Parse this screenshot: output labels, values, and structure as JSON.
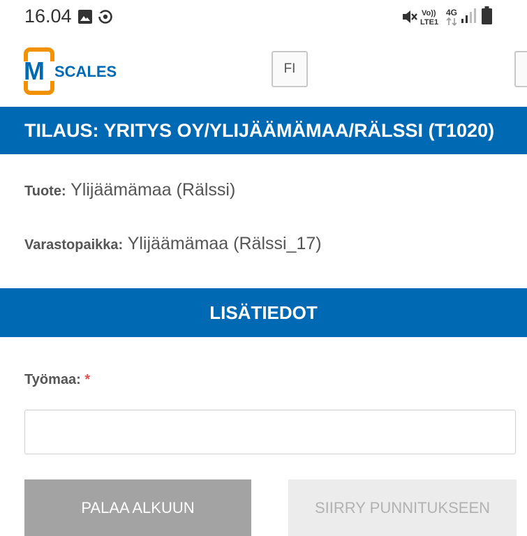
{
  "status_bar": {
    "time": "16.04",
    "icons": [
      "gallery-icon",
      "sync-icon",
      "mute-icon",
      "volte-icon",
      "4g-icon",
      "signal-icon",
      "battery-icon"
    ],
    "volte_top": "Vo))",
    "volte_bottom": "LTE1",
    "network": "4G"
  },
  "header": {
    "logo_text": "SCALES",
    "logo_letter": "M",
    "language_button": "FI",
    "brand_colors": {
      "orange": "#f39200",
      "blue": "#0069b4"
    }
  },
  "order": {
    "title": "TILAUS: YRITYS OY/YLIJÄÄMÄMAA/RÄLSSI (T1020)",
    "product_label": "Tuote:",
    "product_value": "Ylijäämämaa (Rälssi)",
    "storage_label": "Varastopaikka:",
    "storage_value": "Ylijäämämaa (Rälssi_17)"
  },
  "details": {
    "section_title": "LISÄTIEDOT",
    "worksite_label": "Työmaa:",
    "required_mark": "*",
    "worksite_value": "",
    "worksite_placeholder": ""
  },
  "actions": {
    "back_label": "PALAA ALKUUN",
    "next_label": "SIIRRY PUNNITUKSEEN"
  }
}
